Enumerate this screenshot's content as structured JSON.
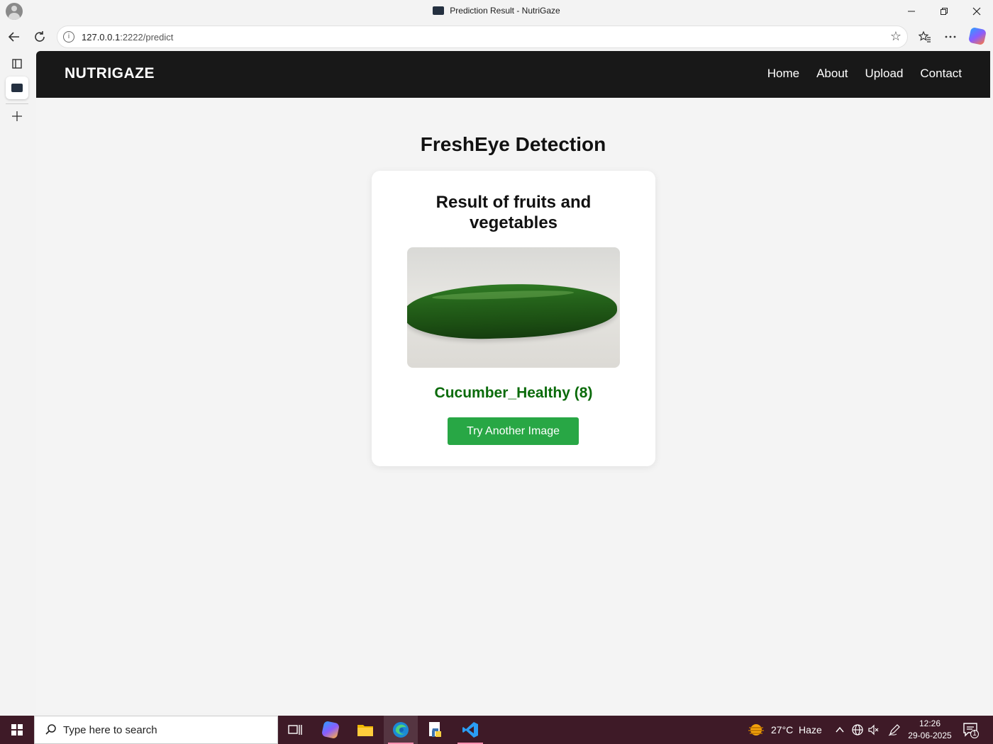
{
  "window": {
    "title": "Prediction Result - NutriGaze"
  },
  "browser": {
    "url_host": "127.0.0.1",
    "url_rest": ":2222/predict"
  },
  "site": {
    "brand": "NUTRIGAZE",
    "nav": [
      "Home",
      "About",
      "Upload",
      "Contact"
    ]
  },
  "main": {
    "heading": "FreshEye Detection",
    "card_title": "Result of fruits and vegetables",
    "result": "Cucumber_Healthy (8)",
    "button": "Try Another Image"
  },
  "taskbar": {
    "search_placeholder": "Type here to search",
    "weather": "27°C  Haze",
    "time": "12:26",
    "date": "29-06-2025",
    "notifications": "1"
  },
  "colors": {
    "navbar": "#181818",
    "result_text": "#0b6b0b",
    "button": "#28a745",
    "taskbar": "#3e1a27"
  }
}
